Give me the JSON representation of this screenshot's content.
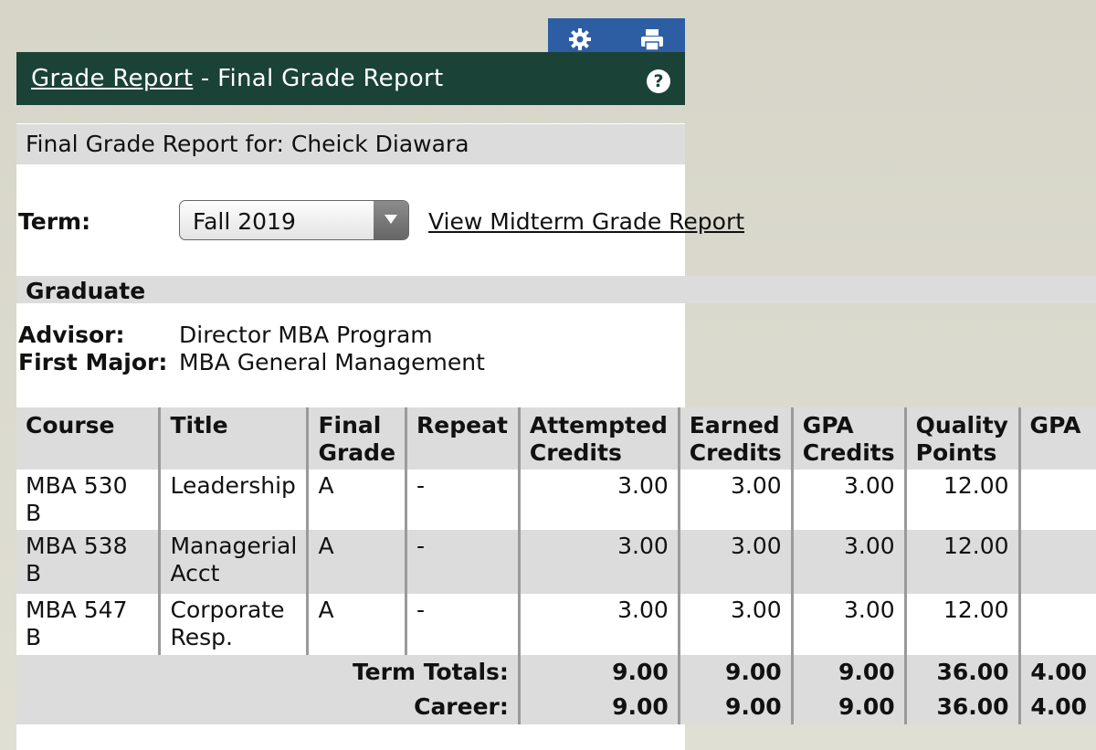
{
  "header": {
    "link_text": "Grade Report",
    "title_rest": " - Final Grade Report",
    "help_glyph": "?"
  },
  "report_for": "Final Grade Report for: Cheick Diawara",
  "term": {
    "label": "Term:",
    "selected": "Fall 2019",
    "midterm_link": "View Midterm Grade Report"
  },
  "section": {
    "title": "Graduate",
    "advisor_label": "Advisor:",
    "advisor_value": "Director MBA Program",
    "major_label": "First Major:",
    "major_value": "MBA General Management"
  },
  "table": {
    "headers": {
      "course": "Course",
      "title": "Title",
      "final_grade_1": "Final",
      "final_grade_2": "Grade",
      "repeat": "Repeat",
      "attempted_1": "Attempted",
      "attempted_2": "Credits",
      "earned_1": "Earned",
      "earned_2": "Credits",
      "gpa_credits_1": "GPA",
      "gpa_credits_2": "Credits",
      "quality_1": "Quality",
      "quality_2": "Points",
      "gpa": "GPA"
    },
    "rows": [
      {
        "course": "MBA 530 B",
        "title_1": "Leadership",
        "title_2": "",
        "grade": "A",
        "repeat": "-",
        "attempted": "3.00",
        "earned": "3.00",
        "gpa_credits": "3.00",
        "quality": "12.00",
        "gpa": ""
      },
      {
        "course": "MBA 538 B",
        "title_1": "Managerial",
        "title_2": "Acct",
        "grade": "A",
        "repeat": "-",
        "attempted": "3.00",
        "earned": "3.00",
        "gpa_credits": "3.00",
        "quality": "12.00",
        "gpa": ""
      },
      {
        "course": "MBA 547 B",
        "title_1": "Corporate",
        "title_2": "Resp.",
        "grade": "A",
        "repeat": "-",
        "attempted": "3.00",
        "earned": "3.00",
        "gpa_credits": "3.00",
        "quality": "12.00",
        "gpa": ""
      }
    ],
    "term_totals": {
      "label": "Term Totals:",
      "attempted": "9.00",
      "earned": "9.00",
      "gpa_credits": "9.00",
      "quality": "36.00",
      "gpa": "4.00"
    },
    "career": {
      "label": "Career:",
      "attempted": "9.00",
      "earned": "9.00",
      "gpa_credits": "9.00",
      "quality": "36.00",
      "gpa": "4.00"
    }
  },
  "colors": {
    "header_bg": "#1b4237",
    "toolbar_bg": "#2d5ea3",
    "row_alt": "#dcdcdc"
  },
  "icons": {
    "settings": "gear-icon",
    "print": "printer-icon",
    "help": "help-icon",
    "dropdown": "chevron-down-icon"
  }
}
